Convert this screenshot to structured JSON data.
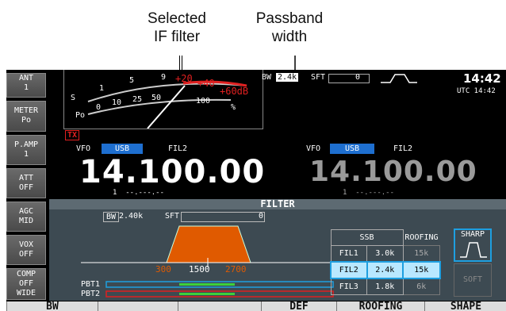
{
  "annotations": {
    "if_filter_line1": "Selected",
    "if_filter_line2": "IF filter",
    "passband_line1": "Passband",
    "passband_line2": "width"
  },
  "softkeys": [
    {
      "line1": "ANT",
      "line2": "1"
    },
    {
      "line1": "METER",
      "line2": "Po"
    },
    {
      "line1": "P.AMP",
      "line2": "1"
    },
    {
      "line1": "ATT",
      "line2": "OFF"
    },
    {
      "line1": "AGC",
      "line2": "MID"
    },
    {
      "line1": "VOX",
      "line2": "OFF"
    },
    {
      "line1": "COMP",
      "line2": "OFF",
      "line3": "WIDE"
    }
  ],
  "top_bar": {
    "bw_label": "BW",
    "bw_value": "2.4k",
    "sft_label": "SFT",
    "sft_value": "0",
    "time": "14:42",
    "utc": "UTC 14:42"
  },
  "meter": {
    "scale_s": [
      "S",
      "1",
      "5",
      "9",
      "+20",
      "+40",
      "+60dB"
    ],
    "scale_po": [
      "Po",
      "0",
      "10",
      "25",
      "50",
      "100",
      "%"
    ],
    "tx": "TX"
  },
  "vfo_main": {
    "label": "VFO",
    "mode": "USB",
    "filter": "FIL2",
    "frequency": "14.100.00",
    "sub": "1  --.---.--"
  },
  "vfo_sub": {
    "label": "VFO",
    "mode": "USB",
    "filter": "FIL2",
    "frequency": "14.100.00",
    "sub": "1  --.---.--"
  },
  "filter_panel": {
    "title": "FILTER",
    "bw_label": "BW",
    "bw_value": "2.40k",
    "sft_label": "SFT",
    "sft_value": "0",
    "scale": [
      "300",
      "1500",
      "2700"
    ],
    "pbt1": "PBT1",
    "pbt2": "PBT2",
    "table_header": "SSB",
    "roofing_header": "ROOFING",
    "rows": [
      {
        "name": "FIL1",
        "value": "3.0k",
        "roofing": "15k"
      },
      {
        "name": "FIL2",
        "value": "2.4k",
        "roofing": "15k"
      },
      {
        "name": "FIL3",
        "value": "1.8k",
        "roofing": "6k"
      }
    ],
    "sharp": "SHARP",
    "soft": "SOFT"
  },
  "bottom_keys": [
    "BW",
    "",
    "",
    "DEF",
    "ROOFING",
    "SHAPE"
  ],
  "colors": {
    "accent_blue": "#1e6fd0",
    "filter_orange": "#e05a00",
    "meter_red": "#e02020"
  }
}
